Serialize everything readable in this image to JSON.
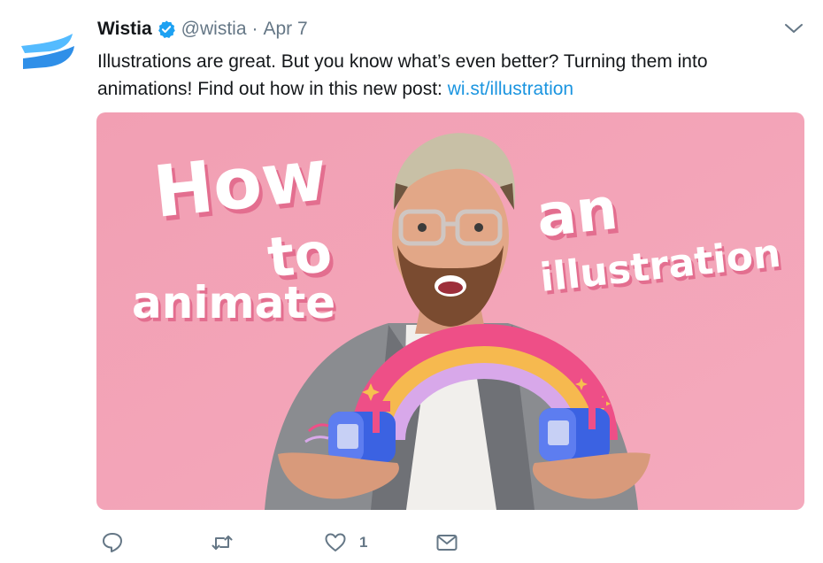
{
  "tweet": {
    "author_name": "Wistia",
    "handle": "@wistia",
    "separator": "·",
    "date": "Apr 7",
    "text_line1": "Illustrations are great. But you know what’s even better? Turning them into",
    "text_line2_prefix": "animations! Find out how in this new post: ",
    "link_text": "wi.st/illustration",
    "verified": true
  },
  "media": {
    "title_words": [
      "How",
      "to",
      "animate",
      "an",
      "illustration"
    ],
    "background_color": "#f3a1b4",
    "accent_colors": {
      "rainbow_outer": "#ee4f87",
      "rainbow_middle": "#f6b94f",
      "rainbow_inner": "#d8a8ea",
      "mailbox": "#3b62e2",
      "flag": "#ee4f87"
    }
  },
  "actions": {
    "reply_icon": "reply-icon",
    "retweet_icon": "retweet-icon",
    "like_icon": "heart-icon",
    "like_count": "1",
    "dm_icon": "envelope-icon"
  },
  "colors": {
    "brand_blue": "#1b95e0",
    "muted_text": "#657786",
    "verified_blue": "#1da1f2",
    "wistia_logo": "#54bbff"
  }
}
